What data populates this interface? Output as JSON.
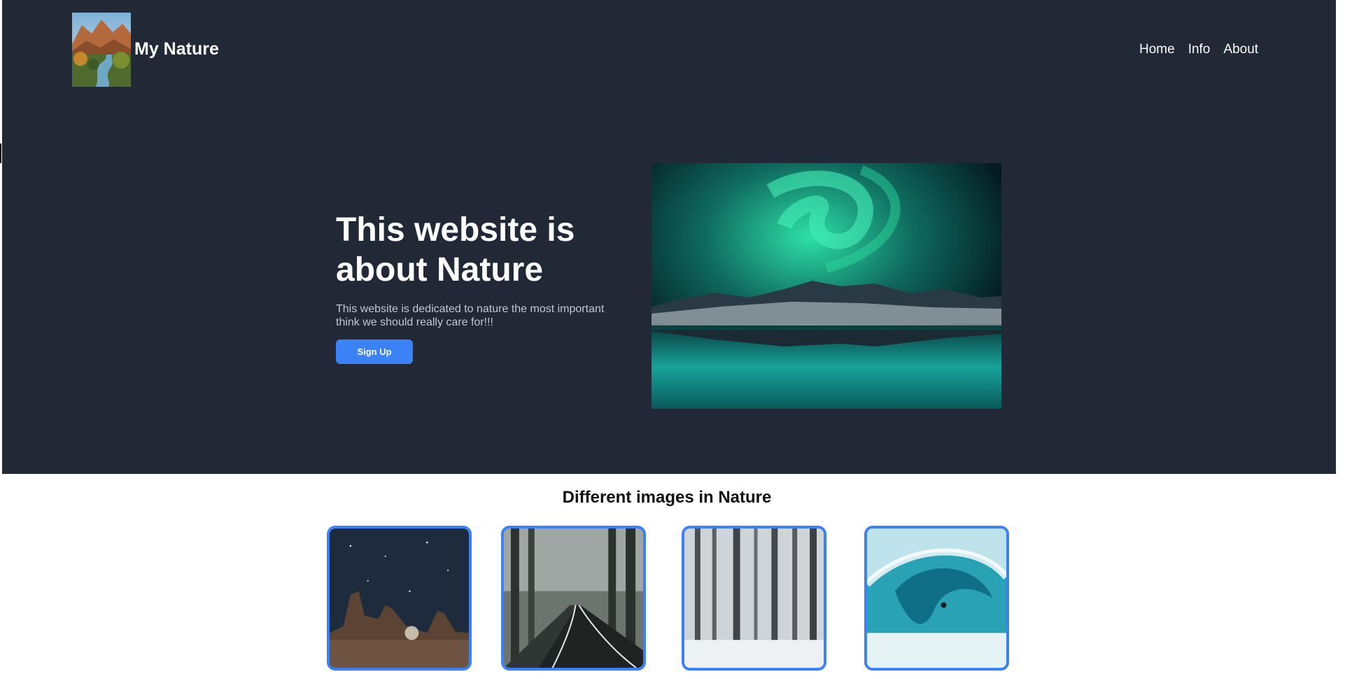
{
  "header": {
    "brand": "My Nature",
    "logo_icon": "canyon-river-logo",
    "nav": [
      {
        "label": "Home"
      },
      {
        "label": "Info"
      },
      {
        "label": "About"
      }
    ]
  },
  "hero": {
    "title": "This website is about Nature",
    "description": "This website is dedicated to nature the most important think we should really care for!!!",
    "cta_label": "Sign Up",
    "image_icon": "aurora-lake-image"
  },
  "gallery": {
    "title": "Different images in Nature",
    "items": [
      {
        "icon": "desert-night-sky-image"
      },
      {
        "icon": "forest-road-image"
      },
      {
        "icon": "snowy-forest-image"
      },
      {
        "icon": "ocean-wave-surfer-image"
      }
    ]
  },
  "colors": {
    "hero_bg": "#212836",
    "accent": "#3b82f6",
    "text_light": "#ffffff",
    "text_muted": "#c3c7d0"
  }
}
